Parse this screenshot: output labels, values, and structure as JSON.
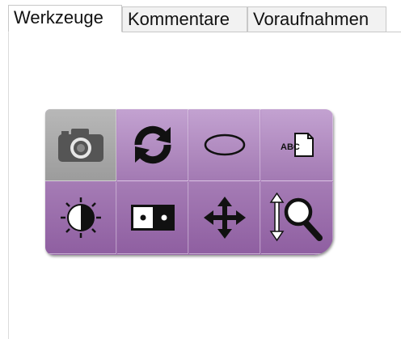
{
  "tabs": [
    {
      "label": "Werkzeuge",
      "active": true
    },
    {
      "label": "Kommentare",
      "active": false
    },
    {
      "label": "Voraufnahmen",
      "active": false
    }
  ],
  "tools": [
    {
      "icon": "camera-icon",
      "selected": true
    },
    {
      "icon": "rotate-icon",
      "selected": false
    },
    {
      "icon": "ellipse-icon",
      "selected": false
    },
    {
      "icon": "text-annotation-icon",
      "text": "ABC",
      "selected": false
    },
    {
      "icon": "contrast-icon",
      "selected": false
    },
    {
      "icon": "invert-icon",
      "selected": false
    },
    {
      "icon": "pan-icon",
      "selected": false
    },
    {
      "icon": "zoom-icon",
      "selected": false
    }
  ],
  "colors": {
    "panel": "#a97fba",
    "selected_cell": "#aaaaaa",
    "icon": "#111111"
  }
}
